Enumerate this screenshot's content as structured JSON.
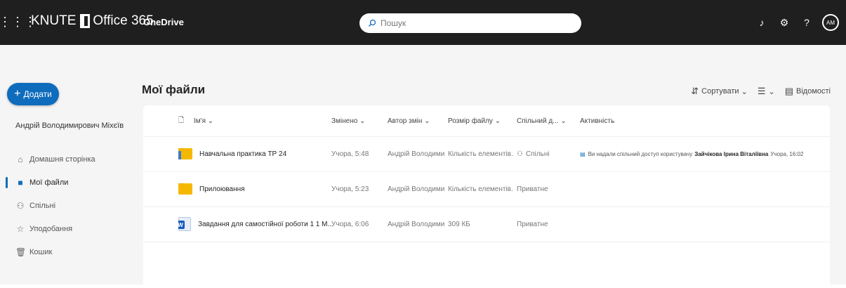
{
  "topbar": {
    "brand": "KNUTE",
    "office": "Office 365",
    "app_name": "OneDrive",
    "search_placeholder": "Пошук",
    "avatar_initials": "АМ"
  },
  "sidebar": {
    "add_label": "Додати",
    "user_name": "Андрій Володимирович Міхєїв",
    "items": [
      {
        "label": "Домашня сторінка",
        "icon": "home-icon"
      },
      {
        "label": "Мої файли",
        "icon": "folder-icon"
      },
      {
        "label": "Спільні",
        "icon": "shared-icon"
      },
      {
        "label": "Уподобання",
        "icon": "star-icon"
      },
      {
        "label": "Кошик",
        "icon": "trash-icon"
      }
    ]
  },
  "main": {
    "title": "Мої файли",
    "toolbar": {
      "sort_label": "Сортувати",
      "view_label": "",
      "details_label": "Відомості"
    },
    "columns": {
      "name": "Ім'я",
      "modified": "Змінено",
      "modified_by": "Автор змін",
      "size": "Розмір файлу",
      "sharing": "Спільний д...",
      "activity": "Активність"
    },
    "rows": [
      {
        "type": "folder",
        "name": "Навчальна практика ТР 24",
        "modified": "Учора, 5:48",
        "modified_by": "Андрій Володимиро",
        "size": "Кількість елементів...",
        "sharing": "Спільні",
        "activity_text": "Ви надали спільний доступ користувачу",
        "activity_user": "Зайчікова Ірина Віталіївна",
        "activity_time": "Учора, 16:02"
      },
      {
        "type": "folder",
        "name": "Прилоювання",
        "modified": "Учора, 5:23",
        "modified_by": "Андрій Володимиро",
        "size": "Кількість елементів...",
        "sharing": "Приватне"
      },
      {
        "type": "word",
        "name": "Завдання для самостійної роботи 1 1 М...",
        "modified": "Учора, 6:06",
        "modified_by": "Андрій Володимиро",
        "size": "309 КБ",
        "sharing": "Приватне"
      }
    ]
  },
  "colors": {
    "accent": "#0f6cbd",
    "topbar_bg": "#1f1f1f",
    "folder": "#f5b800"
  }
}
